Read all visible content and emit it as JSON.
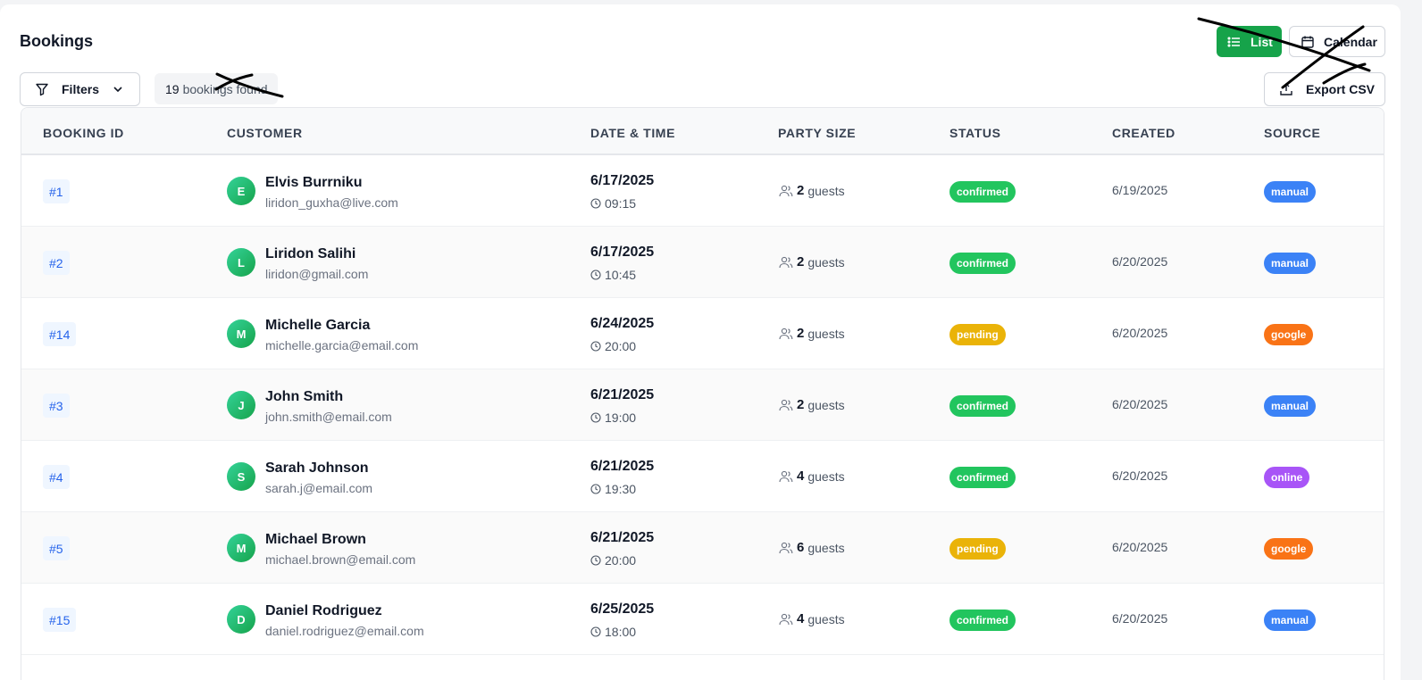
{
  "page": {
    "title": "Bookings"
  },
  "toolbar": {
    "list_label": "List",
    "calendar_label": "Calendar",
    "filters_label": "Filters",
    "export_label": "Export CSV",
    "count_number": "19",
    "count_text": "bookings found"
  },
  "colors": {
    "primary_green": "#16a34a",
    "status_confirmed": "#22c55e",
    "status_pending": "#eab308",
    "source_manual": "#3b82f6",
    "source_google": "#f97316",
    "source_online": "#a855f7"
  },
  "icons": {
    "list": "list-icon",
    "calendar": "calendar-icon",
    "filter": "filter-icon",
    "chevron": "chevron-down-icon",
    "export": "export-icon",
    "clock": "clock-icon",
    "guests": "users-icon"
  },
  "table": {
    "headers": {
      "id": "BOOKING ID",
      "customer": "CUSTOMER",
      "datetime": "DATE & TIME",
      "party": "PARTY SIZE",
      "status": "STATUS",
      "created": "CREATED",
      "source": "SOURCE"
    },
    "guests_suffix": "guests",
    "rows": [
      {
        "id": "#1",
        "initial": "E",
        "name": "Elvis Burrniku",
        "email": "liridon_guxha@live.com",
        "date": "6/17/2025",
        "time": "09:15",
        "party": "2",
        "status": "confirmed",
        "created": "6/19/2025",
        "source": "manual"
      },
      {
        "id": "#2",
        "initial": "L",
        "name": "Liridon Salihi",
        "email": "liridon@gmail.com",
        "date": "6/17/2025",
        "time": "10:45",
        "party": "2",
        "status": "confirmed",
        "created": "6/20/2025",
        "source": "manual"
      },
      {
        "id": "#14",
        "initial": "M",
        "name": "Michelle Garcia",
        "email": "michelle.garcia@email.com",
        "date": "6/24/2025",
        "time": "20:00",
        "party": "2",
        "status": "pending",
        "created": "6/20/2025",
        "source": "google"
      },
      {
        "id": "#3",
        "initial": "J",
        "name": "John Smith",
        "email": "john.smith@email.com",
        "date": "6/21/2025",
        "time": "19:00",
        "party": "2",
        "status": "confirmed",
        "created": "6/20/2025",
        "source": "manual"
      },
      {
        "id": "#4",
        "initial": "S",
        "name": "Sarah Johnson",
        "email": "sarah.j@email.com",
        "date": "6/21/2025",
        "time": "19:30",
        "party": "4",
        "status": "confirmed",
        "created": "6/20/2025",
        "source": "online"
      },
      {
        "id": "#5",
        "initial": "M",
        "name": "Michael Brown",
        "email": "michael.brown@email.com",
        "date": "6/21/2025",
        "time": "20:00",
        "party": "6",
        "status": "pending",
        "created": "6/20/2025",
        "source": "google"
      },
      {
        "id": "#15",
        "initial": "D",
        "name": "Daniel Rodriguez",
        "email": "daniel.rodriguez@email.com",
        "date": "6/25/2025",
        "time": "18:00",
        "party": "4",
        "status": "confirmed",
        "created": "6/20/2025",
        "source": "manual"
      }
    ]
  }
}
